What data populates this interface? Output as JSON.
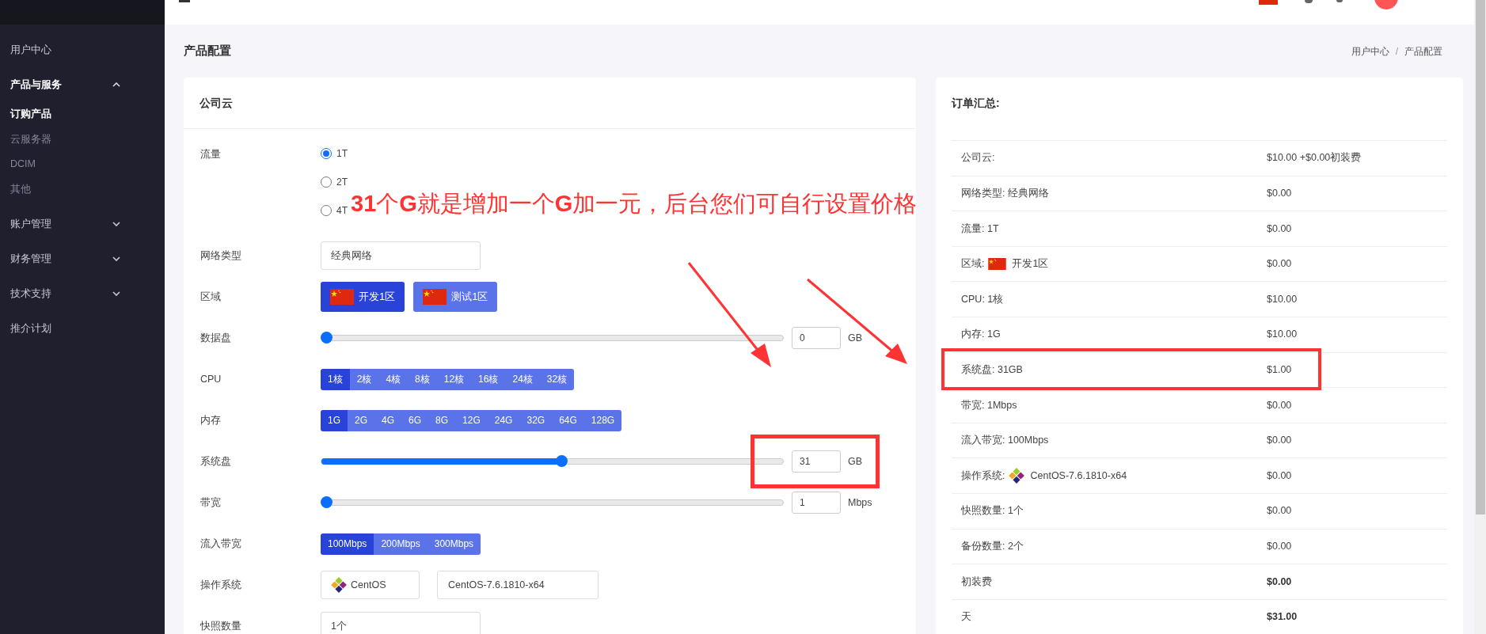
{
  "sidebar": {
    "items": [
      {
        "label": "用户中心"
      },
      {
        "label": "产品与服务",
        "expanded": true,
        "children": [
          {
            "label": "订购产品",
            "selected": true
          },
          {
            "label": "云服务器",
            "selected": false
          },
          {
            "label": "DCIM",
            "selected": false
          },
          {
            "label": "其他",
            "selected": false
          }
        ]
      },
      {
        "label": "账户管理",
        "expanded": false
      },
      {
        "label": "财务管理",
        "expanded": false
      },
      {
        "label": "技术支持",
        "expanded": false
      },
      {
        "label": "推介计划"
      }
    ]
  },
  "page": {
    "title": "产品配置",
    "breadcrumb": [
      "用户中心",
      "产品配置"
    ],
    "breadcrumb_separator": "/"
  },
  "product_card": {
    "title": "公司云",
    "fields": [
      {
        "kind": "radio",
        "label": "流量",
        "options": [
          {
            "label": "1T",
            "selected": true
          },
          {
            "label": "2T",
            "selected": false
          },
          {
            "label": "4T",
            "selected": false
          }
        ]
      },
      {
        "kind": "select",
        "label": "网络类型",
        "value": "经典网络"
      },
      {
        "kind": "flags",
        "label": "区域",
        "options": [
          {
            "label": "开发1区",
            "selected": true
          },
          {
            "label": "测试1区",
            "selected": false
          }
        ]
      },
      {
        "kind": "slider",
        "label": "数据盘",
        "level": 0,
        "value": "0",
        "unit": "GB",
        "boxed": false
      },
      {
        "kind": "segments",
        "label": "CPU",
        "options": [
          {
            "label": "1核",
            "selected": true
          },
          {
            "label": "2核",
            "selected": false
          },
          {
            "label": "4核",
            "selected": false
          },
          {
            "label": "8核",
            "selected": false
          },
          {
            "label": "12核",
            "selected": false
          },
          {
            "label": "16核",
            "selected": false
          },
          {
            "label": "24核",
            "selected": false
          },
          {
            "label": "32核",
            "selected": false
          }
        ]
      },
      {
        "kind": "segments",
        "label": "内存",
        "options": [
          {
            "label": "1G",
            "selected": true
          },
          {
            "label": "2G",
            "selected": false
          },
          {
            "label": "4G",
            "selected": false
          },
          {
            "label": "6G",
            "selected": false
          },
          {
            "label": "8G",
            "selected": false
          },
          {
            "label": "12G",
            "selected": false
          },
          {
            "label": "24G",
            "selected": false
          },
          {
            "label": "32G",
            "selected": false
          },
          {
            "label": "64G",
            "selected": false
          },
          {
            "label": "128G",
            "selected": false
          }
        ]
      },
      {
        "kind": "slider",
        "label": "系统盘",
        "level": 0.52,
        "value": "31",
        "unit": "GB",
        "boxed": true
      },
      {
        "kind": "slider",
        "label": "带宽",
        "level": 0,
        "value": "1",
        "unit": "Mbps",
        "boxed": false
      },
      {
        "kind": "segments",
        "label": "流入带宽",
        "options": [
          {
            "label": "100Mbps",
            "selected": true
          },
          {
            "label": "200Mbps",
            "selected": false
          },
          {
            "label": "300Mbps",
            "selected": false
          }
        ]
      },
      {
        "kind": "os",
        "label": "操作系统",
        "os": "CentOS",
        "version": "CentOS-7.6.1810-x64"
      },
      {
        "kind": "input",
        "label": "快照数量",
        "value": "1个"
      }
    ]
  },
  "note": "**31**个**G**就是增加一个**G**加一元，后台您们可自行设置价格",
  "summary": {
    "title": "订单汇总:",
    "rows": [
      {
        "kind": "text",
        "label": "公司云:",
        "price": "$10.00 +$0.00初装费",
        "boxed": false
      },
      {
        "kind": "text",
        "label": "网络类型: 经典网络",
        "price": "$0.00",
        "boxed": false
      },
      {
        "kind": "text",
        "label": "流量: 1T",
        "price": "$0.00",
        "boxed": false
      },
      {
        "kind": "flag",
        "label": "区域:",
        "value": "开发1区",
        "price": "$0.00",
        "boxed": false
      },
      {
        "kind": "text",
        "label": "CPU: 1核",
        "price": "$10.00",
        "boxed": false
      },
      {
        "kind": "text",
        "label": "内存: 1G",
        "price": "$10.00",
        "boxed": false
      },
      {
        "kind": "text",
        "label": "系统盘: 31GB",
        "price": "$1.00",
        "boxed": true
      },
      {
        "kind": "text",
        "label": "带宽: 1Mbps",
        "price": "$0.00",
        "boxed": false
      },
      {
        "kind": "text",
        "label": "流入带宽: 100Mbps",
        "price": "$0.00",
        "boxed": false
      },
      {
        "kind": "os",
        "label": "操作系统:",
        "value": "CentOS-7.6.1810-x64",
        "price": "$0.00",
        "boxed": false
      },
      {
        "kind": "text",
        "label": "快照数量: 1个",
        "price": "$0.00",
        "boxed": false
      },
      {
        "kind": "text",
        "label": "备份数量: 2个",
        "price": "$0.00",
        "boxed": false
      },
      {
        "kind": "total",
        "label": "初装费",
        "price": "$0.00",
        "boxed": false
      },
      {
        "kind": "total",
        "label": "天",
        "price": "$31.00",
        "boxed": false
      }
    ]
  }
}
